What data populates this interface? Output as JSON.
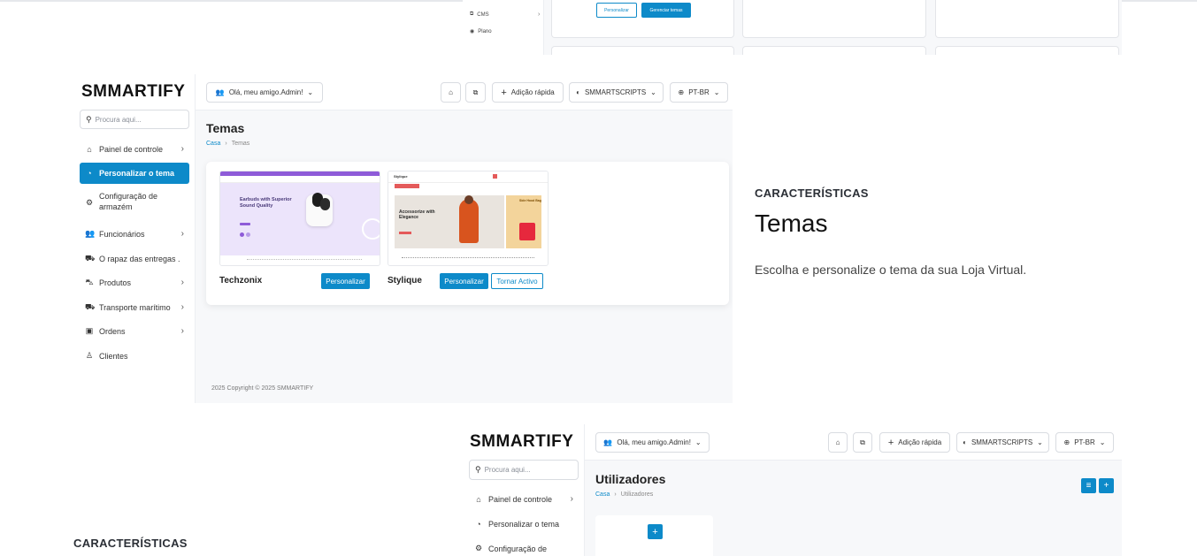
{
  "top_shot": {
    "sidebar_items": [
      {
        "label": "CMS",
        "icon": "cms-icon"
      },
      {
        "label": "Plano",
        "icon": "eye-icon"
      }
    ],
    "personalizar_label": "Personalizar",
    "gerenciar_label": "Gerenciar temas"
  },
  "main_shot": {
    "logo": "SMMARTIFY",
    "search_placeholder": "Procura aqui...",
    "sidebar": [
      {
        "label": "Painel de controle",
        "icon": "home-icon",
        "chevron": true
      },
      {
        "label": "Personalizar o tema",
        "icon": "theme-icon",
        "active": true
      },
      {
        "label": "Configuração de armazém",
        "icon": "settings-icon"
      },
      {
        "label": "Funcionários",
        "icon": "users-icon",
        "chevron": true
      },
      {
        "label": "O rapaz das entregas .",
        "icon": "truck-icon"
      },
      {
        "label": "Produtos",
        "icon": "cart-icon",
        "chevron": true
      },
      {
        "label": "Transporte marítimo",
        "icon": "ship-icon",
        "chevron": true
      },
      {
        "label": "Ordens",
        "icon": "bag-icon",
        "chevron": true
      },
      {
        "label": "Clientes",
        "icon": "user-icon"
      }
    ],
    "header": {
      "greeting": "Olá, meu amigo.Admin!",
      "quick_add": "Adição rápida",
      "store": "SMMARTSCRIPTS",
      "lang": "PT-BR"
    },
    "title": "Temas",
    "breadcrumb": {
      "home": "Casa",
      "current": "Temas"
    },
    "themes": [
      {
        "name": "Techzonix",
        "personalize": "Personalizar",
        "preview_headline": "Earbuds with Superior Sound Quality"
      },
      {
        "name": "Stylique",
        "personalize": "Personalizar",
        "activate": "Tornar Activo",
        "preview_headline": "Accessorize with Elegance",
        "preview_side": "Side Hood Bag"
      }
    ],
    "copyright": "2025 Copyright © 2025 SMMARTIFY"
  },
  "feature": {
    "label": "CARACTERÍSTICAS",
    "title": "Temas",
    "description": "Escolha e personalize o tema da sua Loja Virtual."
  },
  "bottom_shot": {
    "logo": "SMMARTIFY",
    "search_placeholder": "Procura aqui...",
    "sidebar": [
      {
        "label": "Painel de controle",
        "icon": "home-icon",
        "chevron": true
      },
      {
        "label": "Personalizar o tema",
        "icon": "theme-icon"
      },
      {
        "label": "Configuração de",
        "icon": "settings-icon"
      }
    ],
    "header": {
      "greeting": "Olá, meu amigo.Admin!",
      "quick_add": "Adição rápida",
      "store": "SMMARTSCRIPTS",
      "lang": "PT-BR"
    },
    "title": "Utilizadores",
    "breadcrumb": {
      "home": "Casa",
      "current": "Utilizadores"
    }
  },
  "feature2": {
    "label": "CARACTERÍSTICAS"
  },
  "colors": {
    "accent": "#0d8ac9",
    "background": "#f7f8fa"
  }
}
